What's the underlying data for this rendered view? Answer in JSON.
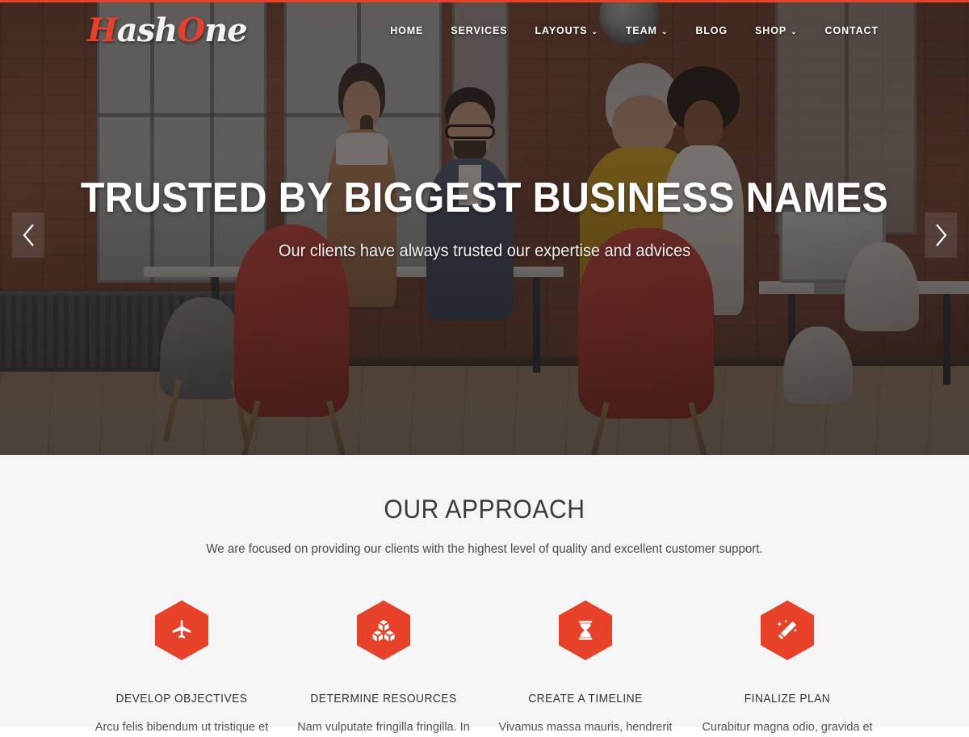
{
  "theme": {
    "accent_red": "#e8412a",
    "section_bg": "#f5f5f5",
    "hero_overlay": "rgba(28,22,22,0.62)"
  },
  "header": {
    "logo": {
      "full": "HashOne",
      "part_1": "H",
      "part_2": "ash",
      "part_3": "O",
      "part_4": "ne"
    },
    "nav": [
      {
        "label": "HOME",
        "has_dropdown": false,
        "caret": ""
      },
      {
        "label": "SERVICES",
        "has_dropdown": false,
        "caret": ""
      },
      {
        "label": "LAYOUTS",
        "has_dropdown": true,
        "caret": "⌄"
      },
      {
        "label": "TEAM",
        "has_dropdown": true,
        "caret": "⌄"
      },
      {
        "label": "BLOG",
        "has_dropdown": false,
        "caret": ""
      },
      {
        "label": "SHOP",
        "has_dropdown": true,
        "caret": "⌄"
      },
      {
        "label": "CONTACT",
        "has_dropdown": false,
        "caret": ""
      }
    ]
  },
  "hero": {
    "title": "TRUSTED BY BIGGEST BUSINESS NAMES",
    "subtitle": "Our clients have always trusted our expertise and advices",
    "prev_icon": "chevron-left-icon",
    "next_icon": "chevron-right-icon"
  },
  "approach": {
    "title": "OUR APPROACH",
    "subtitle": "We are focused on providing our clients with the highest level of quality and excellent customer support.",
    "features": [
      {
        "icon": "airplane-icon",
        "title": "DEVELOP OBJECTIVES",
        "desc": "Arcu felis bibendum ut tristique et"
      },
      {
        "icon": "cubes-icon",
        "title": "DETERMINE RESOURCES",
        "desc": "Nam vulputate fringilla fringilla. In"
      },
      {
        "icon": "hourglass-icon",
        "title": "CREATE A TIMELINE",
        "desc": "Vivamus massa mauris, hendrerit"
      },
      {
        "icon": "magic-wand-icon",
        "title": "FINALIZE PLAN",
        "desc": "Curabitur magna odio, gravida et"
      }
    ]
  }
}
